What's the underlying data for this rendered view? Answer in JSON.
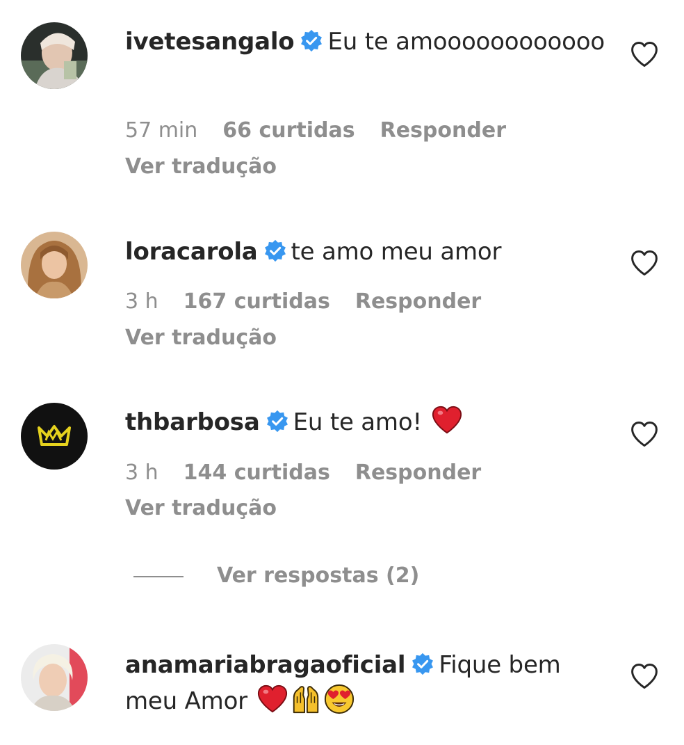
{
  "comments": [
    {
      "username": "ivetesangalo",
      "text": "Eu te amoooooooooooo",
      "time": "57 min",
      "likes": "66 curtidas",
      "reply": "Responder",
      "translate": "Ver tradução"
    },
    {
      "username": "loracarola",
      "text": "te amo meu amor",
      "time": "3 h",
      "likes": "167 curtidas",
      "reply": "Responder",
      "translate": "Ver tradução"
    },
    {
      "username": "thbarbosa",
      "text": "Eu te amo!",
      "time": "3 h",
      "likes": "144 curtidas",
      "reply": "Responder",
      "translate": "Ver tradução",
      "emojis": [
        "red-heart"
      ]
    },
    {
      "username": "anamariabragaoficial",
      "text": "Fique bem meu Amor",
      "emojis": [
        "red-heart",
        "raising-hands",
        "heart-eyes"
      ]
    }
  ],
  "replies_link": "Ver respostas (2)",
  "colors": {
    "text": "#262626",
    "secondary": "#8e8e8e",
    "verified": "#3897f0",
    "heart_emoji": "#e0202e"
  }
}
